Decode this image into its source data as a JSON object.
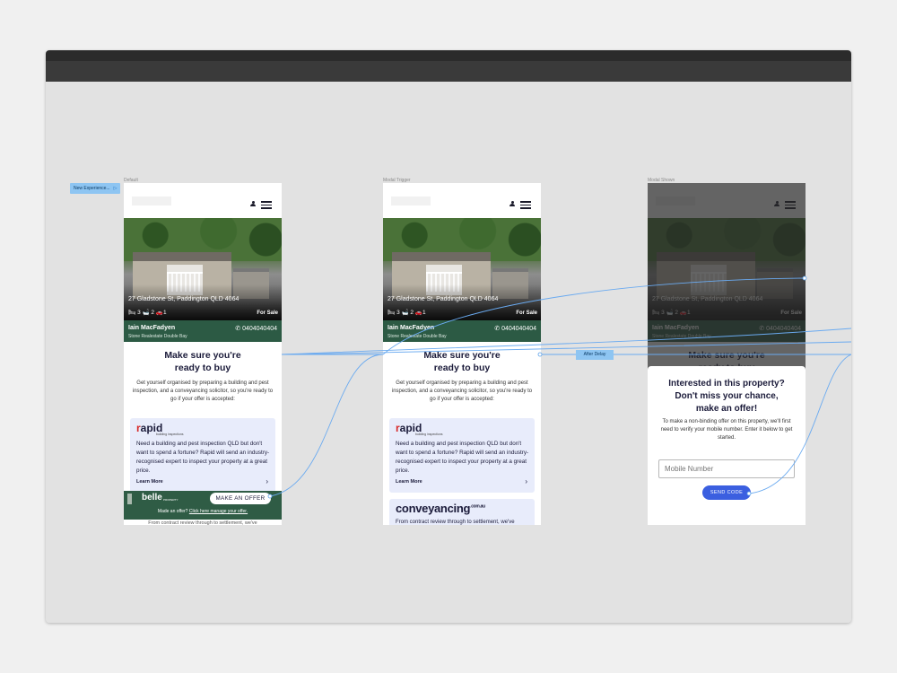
{
  "frames": {
    "default_label": "Default",
    "trigger_label": "Modal Trigger",
    "shown_label": "Modal Shown"
  },
  "flow": {
    "start_label": "New Experience...",
    "delay_label": "After Delay"
  },
  "listing": {
    "address": "27 Gladstone St, Paddington QLD 4064",
    "beds": "3",
    "baths": "2",
    "cars": "1",
    "status": "For Sale",
    "agent_name": "Iain MacFadyen",
    "agency": "Stone Realestate Double Bay",
    "phone": "0404040404"
  },
  "section": {
    "title_line1": "Make sure you're",
    "title_line2": "ready to buy",
    "description": "Get yourself organised by preparing a building and pest inspection, and a conveyancing solicitor, so you're ready to go if your offer is accepted:"
  },
  "rapid": {
    "logo_r": "r",
    "logo_rest": "apid",
    "tagline": "building inspections",
    "text": "Need a building and pest inspection QLD but don't want to spend a fortune? Rapid will send an industry-recognised expert to inspect your property at a great price.",
    "learn_more": "Learn More"
  },
  "conveyancing": {
    "logo": "conveyancing",
    "logo_suffix": ".com.au",
    "peek_text": "From contract review through to settlement, we've"
  },
  "belle": {
    "logo": "belle",
    "sub": "PROPERTY",
    "offer_button": "MAKE AN OFFER",
    "manage_prefix": "Made an offer? ",
    "manage_link": "Click here manage your offer."
  },
  "modal": {
    "title_line1": "Interested in this property?",
    "title_line2": "Don't miss your chance,",
    "title_line3": "make an offer!",
    "description": "To make a non-binding offer on this property, we'll first need to verify your mobile number. Enter it below to get started.",
    "input_placeholder": "Mobile Number",
    "send_button": "SEND CODE"
  },
  "icons": {
    "user": "user-icon",
    "menu": "menu-icon",
    "bed": "bed-icon",
    "bath": "bath-icon",
    "car": "car-icon",
    "phone": "phone-icon",
    "chevron": "chevron-right-icon",
    "play": "play-icon"
  },
  "colors": {
    "agent_bar": "#2c5a44",
    "card_bg": "#e8ecfb",
    "send_button": "#3b5fe0",
    "flow_line": "#6aaaf0",
    "flow_tag": "#8ec5f2"
  }
}
